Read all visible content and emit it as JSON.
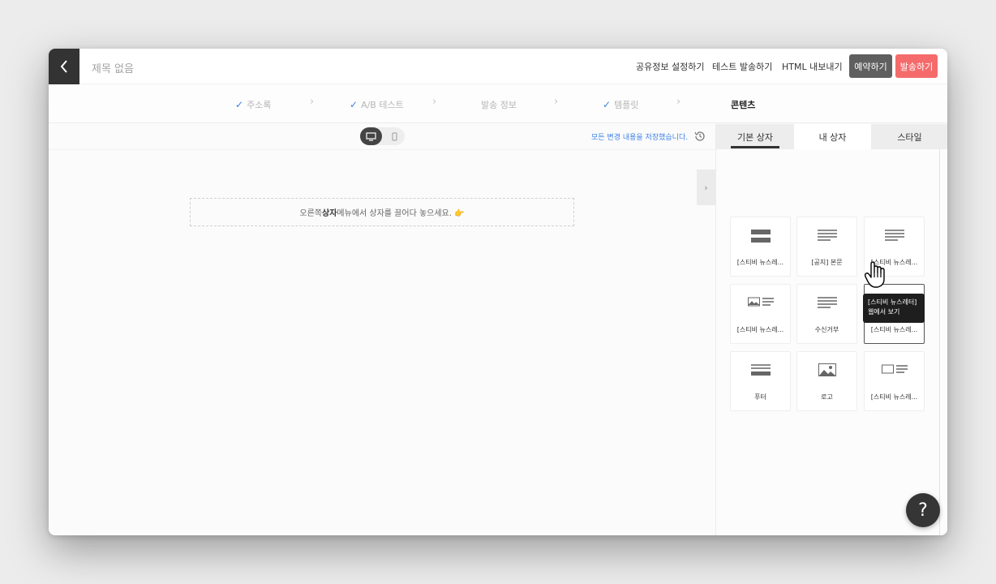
{
  "header": {
    "title": "제목 없음",
    "share_settings": "공유정보 설정하기",
    "test_send": "테스트 발송하기",
    "html_export": "HTML 내보내기",
    "reserve": "예약하기",
    "send": "발송하기"
  },
  "steps": [
    {
      "label": "주소록",
      "done": true
    },
    {
      "label": "A/B 테스트",
      "done": true
    },
    {
      "label": "발송 정보",
      "done": false
    },
    {
      "label": "템플릿",
      "done": true
    },
    {
      "label": "콘텐츠",
      "done": false,
      "active": true
    }
  ],
  "canvas": {
    "saved_message": "모든 변경 내용을 저장했습니다.",
    "drop_prefix": "오른쪽 ",
    "drop_bold": "상자",
    "drop_suffix": " 메뉴에서 상자를 끌어다 놓으세요. 👉"
  },
  "panel": {
    "tabs": [
      "기본 상자",
      "내 상자",
      "스타일"
    ],
    "active_tab": "기본 상자",
    "blocks": [
      {
        "label": "[스티비 뉴스레...",
        "icon": "bars-icon"
      },
      {
        "label": "[공지] 본문",
        "icon": "text-lines-icon"
      },
      {
        "label": "[스티비 뉴스레...",
        "icon": "text-lines-icon"
      },
      {
        "label": "[스티비 뉴스레...",
        "icon": "image-text-icon"
      },
      {
        "label": "수신거부",
        "icon": "text-lines-icon"
      },
      {
        "label": "[스티비 뉴스레...",
        "icon": "text-lines-icon"
      },
      {
        "label": "푸터",
        "icon": "footer-icon"
      },
      {
        "label": "로고",
        "icon": "image-icon"
      },
      {
        "label": "[스티비 뉴스레...",
        "icon": "image-text-icon"
      }
    ],
    "tooltip_line1": "[스티비 뉴스레터]",
    "tooltip_line2": "웹에서 보기"
  },
  "help": "?",
  "colors": {
    "accent": "#3d82e8",
    "send": "#f56b6b",
    "reserve": "#5f5f5f",
    "dark": "#333333"
  }
}
